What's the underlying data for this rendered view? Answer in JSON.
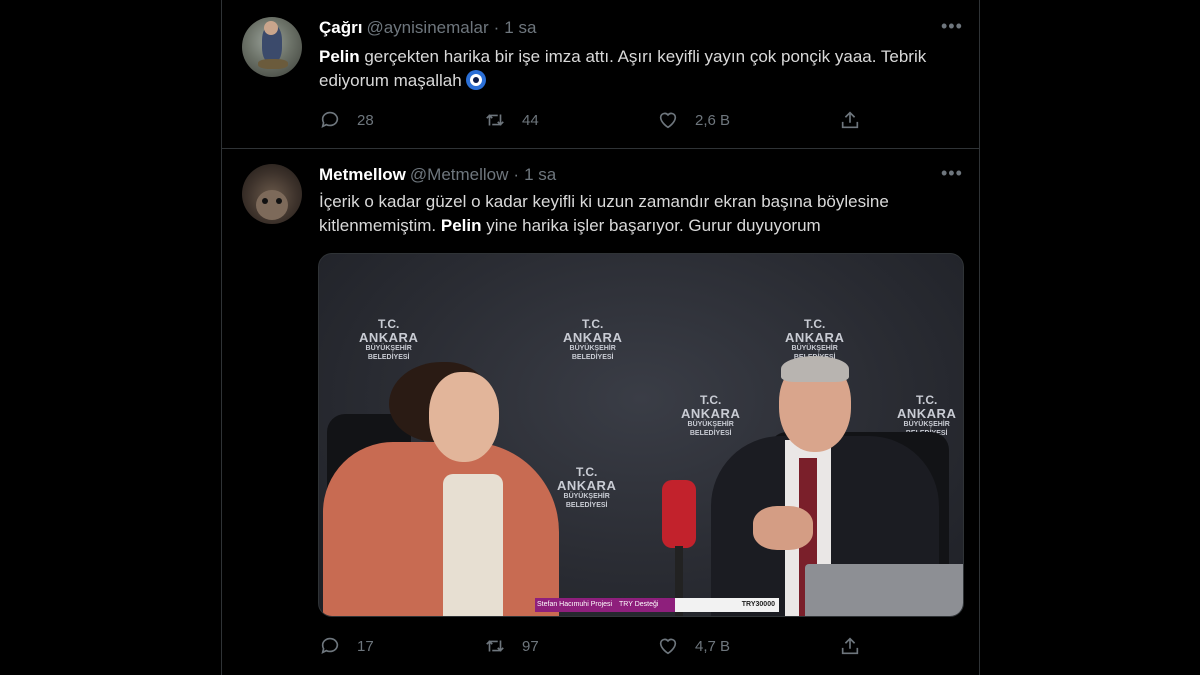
{
  "tweets": [
    {
      "name": "Çağrı",
      "handle": "@aynisinemalar",
      "separator": "·",
      "time": "1 sa",
      "text_bold": "Pelin",
      "text_rest": " gerçekten harika bir işe imza attı. Aşırı keyifli yayın çok ponçik yaaa. Tebrik ediyorum maşallah",
      "emoji_icon": "nazar-evil-eye-icon",
      "replies": "28",
      "retweets": "44",
      "likes": "2,6 B"
    },
    {
      "name": "Metmellow",
      "handle": "@Metmellow",
      "separator": "·",
      "time": "1 sa",
      "text_pre": "İçerik o kadar güzel o kadar keyifli ki uzun zamandır ekran başına böylesine kitlenmemiştim. ",
      "text_bold": "Pelin",
      "text_post": " yine harika işler başarıyor. Gurur duyuyorum",
      "replies": "17",
      "retweets": "97",
      "likes": "4,7 B",
      "media": {
        "backdrop_tc": "T.C.",
        "backdrop_ankara": "ANKARA",
        "backdrop_sub1": "BÜYÜKŞEHİR",
        "backdrop_sub2": "BELEDİYESİ",
        "donation_label": "Stefan Hacımuhi Projesi",
        "donation_sub": "TRY Desteği",
        "donation_amount": "TRY30000"
      }
    }
  ],
  "colors": {
    "background": "#000000",
    "border": "#2f3336",
    "secondary_text": "#6e767d",
    "primary_text": "#d9d9d9"
  }
}
